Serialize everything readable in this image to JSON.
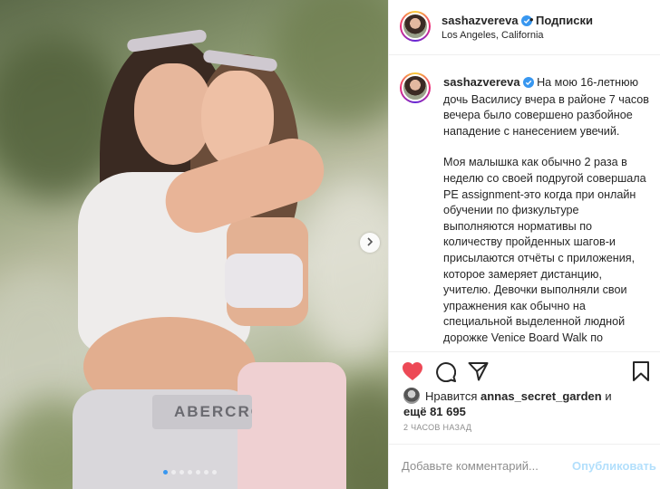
{
  "post": {
    "username": "sashazvereva",
    "follow_label": "Подписки",
    "separator": "•",
    "location": "Los Angeles, California",
    "photo_waistband_text": "ABERCRO",
    "carousel": {
      "dot_count": 7,
      "active_index": 0
    }
  },
  "caption": {
    "username": "sashazvereva",
    "paragraphs": [
      "На мою 16-летнюю дочь Василису вчера в районе 7 часов вечера было совершено разбойное нападение с нанесением увечий.",
      "Моя малышка как обычно 2 раза в неделю со своей подругой совершала PE assignment-это когда при онлайн обучении по физкультуре выполняются нормативы по количеству пройденных шагов-и присылаются отчёты с приложения, которое замеряет дистанцию, учителю. Девочки выполняли свои упражнения как обычно на специальной выделенной людной дорожке Venice Board Walk по"
    ]
  },
  "likes": {
    "prefix": "Нравится",
    "user": "annas_secret_garden",
    "conjunction": "и",
    "more_prefix": "ещё",
    "count": "81 695"
  },
  "timestamp": "2 ЧАСОВ НАЗАД",
  "comment": {
    "placeholder": "Добавьте комментарий...",
    "publish_label": "Опубликовать"
  },
  "icons": {
    "like": "heart-icon",
    "comment": "comment-bubble-icon",
    "share": "paper-plane-icon",
    "save": "bookmark-icon",
    "next": "chevron-right-icon",
    "verified": "verified-badge-icon"
  },
  "colors": {
    "like_red": "#ed4956",
    "verified_blue": "#3897f0",
    "publish_disabled": "#b2dffc",
    "muted_text": "#8e8e8e"
  }
}
